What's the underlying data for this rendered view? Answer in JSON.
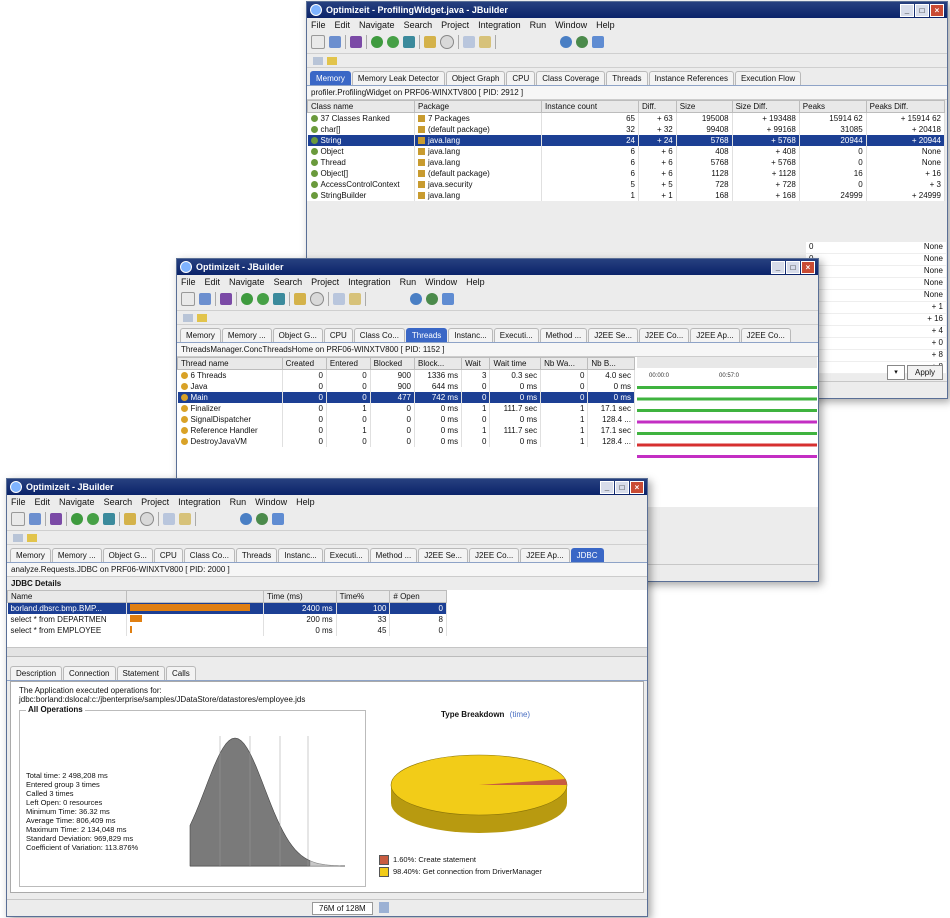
{
  "menu": [
    "File",
    "Edit",
    "Navigate",
    "Search",
    "Project",
    "Integration",
    "Run",
    "Window",
    "Help"
  ],
  "win1": {
    "title": "Optimizeit - ProfilingWidget.java - JBuilder",
    "tabs": [
      "Memory",
      "Memory Leak Detector",
      "Object Graph",
      "CPU",
      "Class Coverage",
      "Threads",
      "Instance References",
      "Execution Flow"
    ],
    "subtitle": "profiler.ProfilingWidget on PRF06-WINXTV800 [ PID: 2912 ]",
    "columns": [
      "Class name",
      "Package",
      "Instance count",
      "Diff.",
      "Size",
      "Size Diff.",
      "Peaks",
      "Peaks Diff."
    ],
    "rows": [
      [
        "37 Classes Ranked",
        "7 Packages",
        "65",
        "+ 63",
        "195008",
        "+ 193488",
        "15914 62",
        "+ 15914 62"
      ],
      [
        "char[]",
        "(default package)",
        "32",
        "+ 32",
        "99408",
        "+ 99168",
        "31085",
        "+ 20418"
      ],
      [
        "String",
        "java.lang",
        "24",
        "+ 24",
        "5768",
        "+ 5768",
        "20944",
        "+ 20944"
      ],
      [
        "Object",
        "java.lang",
        "6",
        "+ 6",
        "408",
        "+ 408",
        "0",
        "None"
      ],
      [
        "Thread",
        "java.lang",
        "6",
        "+ 6",
        "5768",
        "+ 5768",
        "0",
        "None"
      ],
      [
        "Object[]",
        "(default package)",
        "6",
        "+ 6",
        "1128",
        "+ 1128",
        "16",
        "+ 16"
      ],
      [
        "AccessControlContext",
        "java.security",
        "5",
        "+ 5",
        "728",
        "+ 728",
        "0",
        "+ 3"
      ],
      [
        "StringBuilder",
        "java.lang",
        "1",
        "+ 1",
        "168",
        "+ 168",
        "24999",
        "+ 24999"
      ]
    ],
    "peaks_col": [
      "0",
      "0",
      "0",
      "0",
      "0",
      "1",
      "16",
      "4",
      "0",
      "8",
      "16"
    ],
    "peaksdiff_col": [
      "None",
      "None",
      "None",
      "None",
      "None",
      "+ 1",
      "+ 16",
      "+ 4",
      "+ 0",
      "+ 8",
      "+ 8"
    ],
    "apply": "Apply"
  },
  "win2": {
    "title": "Optimizeit - JBuilder",
    "tabs": [
      "Memory",
      "Memory ...",
      "Object G...",
      "CPU",
      "Class Co...",
      "Threads",
      "Instanc...",
      "Executi...",
      "Method ...",
      "J2EE Se...",
      "J2EE Co...",
      "J2EE Ap...",
      "J2EE Co..."
    ],
    "subtitle": "ThreadsManager.ConcThreadsHome on PRF06-WINXTV800 [ PID: 1152 ]",
    "columns": [
      "Thread name",
      "Created",
      "Entered",
      "Blocked",
      "Block...",
      "Wait",
      "Wait time",
      "Nb Wa...",
      "Nb B..."
    ],
    "rows": [
      [
        "6 Threads",
        "0",
        "0",
        "900",
        "1336 ms",
        "3",
        "0.3 sec",
        "0",
        "4.0 sec"
      ],
      [
        "Java",
        "0",
        "0",
        "900",
        "644 ms",
        "0",
        "0 ms",
        "0",
        "0 ms"
      ],
      [
        "Main",
        "0",
        "0",
        "477",
        "742 ms",
        "0",
        "0 ms",
        "0",
        "0 ms"
      ],
      [
        "Finalizer",
        "0",
        "1",
        "0",
        "0 ms",
        "1",
        "111.7 sec",
        "1",
        "17.1 sec"
      ],
      [
        "SignalDispatcher",
        "0",
        "0",
        "0",
        "0 ms",
        "0",
        "0 ms",
        "1",
        "128.4 ..."
      ],
      [
        "Reference Handler",
        "0",
        "1",
        "0",
        "0 ms",
        "1",
        "111.7 sec",
        "1",
        "17.1 sec"
      ],
      [
        "DestroyJavaVM",
        "0",
        "0",
        "0",
        "0 ms",
        "0",
        "0 ms",
        "1",
        "128.4 ..."
      ]
    ],
    "timeline_labels": [
      "00:00:0",
      "00:57:0"
    ]
  },
  "win3": {
    "title": "Optimizeit - JBuilder",
    "tabs": [
      "Memory",
      "Memory ...",
      "Object G...",
      "CPU",
      "Class Co...",
      "Threads",
      "Instanc...",
      "Executi...",
      "Method ...",
      "J2EE Se...",
      "J2EE Co...",
      "J2EE Ap...",
      "JDBC"
    ],
    "subtitle": "analyze.Requests.JDBC on PRF06-WINXTV800 [ PID: 2000 ]",
    "section": "JDBC Details",
    "columns": [
      "Name",
      "",
      "Time (ms)",
      "Time%",
      "# Open"
    ],
    "rows": [
      [
        "borland.dbsrc.bmp.BMP...",
        "",
        "2400 ms",
        "100",
        "0"
      ],
      [
        "select * from DEPARTMEN",
        "",
        "200 ms",
        "33",
        "8"
      ],
      [
        "select * from EMPLOYEE",
        "",
        "0 ms",
        "45",
        "0"
      ]
    ],
    "bottom_tabs": [
      "Description",
      "Connection",
      "Statement",
      "Calls"
    ],
    "desc_line1": "The Application executed operations for:",
    "desc_line2": "jdbc:borland:dslocal:c:/jbenterprise/samples/JDataStore/datastores/employee.jds",
    "ops_title": "All Operations",
    "stats": [
      "Total time: 2 498,208 ms",
      "Entered group 3 times",
      "Called 3 times",
      "Left Open: 0 resources",
      "Minimum Time: 36.32 ms",
      "Average Time: 806,409 ms",
      "Maximum Time: 2 134,048 ms",
      "Standard Deviation: 969,829 ms",
      "Coefficient of Variation: 113.876%"
    ],
    "pie_title": "Type Breakdown",
    "pie_sub": "(time)",
    "legend": [
      {
        "label": "1.60%: Create statement",
        "color": "#c85c40"
      },
      {
        "label": "98.40%: Get connection from DriverManager",
        "color": "#f2cc18"
      }
    ],
    "memory": "76M of 128M"
  }
}
